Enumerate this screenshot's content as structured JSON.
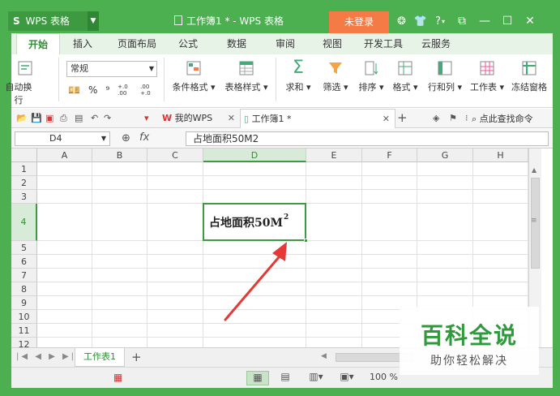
{
  "app": {
    "logo_glyph": "S",
    "name": "WPS 表格",
    "doc_title": "工作簿1 * - WPS 表格",
    "login_label": "未登录"
  },
  "ribbon": {
    "tabs": [
      "开始",
      "插入",
      "页面布局",
      "公式",
      "数据",
      "审阅",
      "视图",
      "开发工具",
      "云服务"
    ],
    "active_tab": "开始",
    "wrap_label": "自动换行",
    "number_format": "常规",
    "percent_glyph": "%",
    "comma_glyph": "⁹",
    "dec_increase": "+.0 .00",
    "dec_decrease": ".00 +.0",
    "tools": [
      "条件格式 ▾",
      "表格样式 ▾",
      "求和 ▾",
      "筛选 ▾",
      "排序 ▾",
      "格式 ▾",
      "行和列 ▾",
      "工作表 ▾",
      "冻结窗格"
    ]
  },
  "doc_tabs": {
    "my_wps": "我的WPS",
    "workbook": "工作簿1 *",
    "search_label": "点此查找命令"
  },
  "formula_bar": {
    "name_box": "D4",
    "fx_label": "fx",
    "content": "占地面积50M2"
  },
  "grid": {
    "columns": [
      "A",
      "B",
      "C",
      "D",
      "E",
      "F",
      "G",
      "H"
    ],
    "rows": [
      "1",
      "2",
      "3",
      "4",
      "5",
      "6",
      "7",
      "8",
      "9",
      "10",
      "11",
      "12"
    ],
    "active_cell": "D4",
    "active_cell_text": "占地面积50M",
    "active_cell_superscript": "2"
  },
  "sheets": {
    "tabs": [
      "工作表1"
    ],
    "add_label": "+"
  },
  "status": {
    "zoom": "100 %"
  },
  "watermark": {
    "main": "百科全说",
    "sub": "助你轻松解决"
  },
  "colors": {
    "brand_green": "#4caf50",
    "accent_orange": "#f47b45",
    "annotation_arrow": "#e53935"
  }
}
